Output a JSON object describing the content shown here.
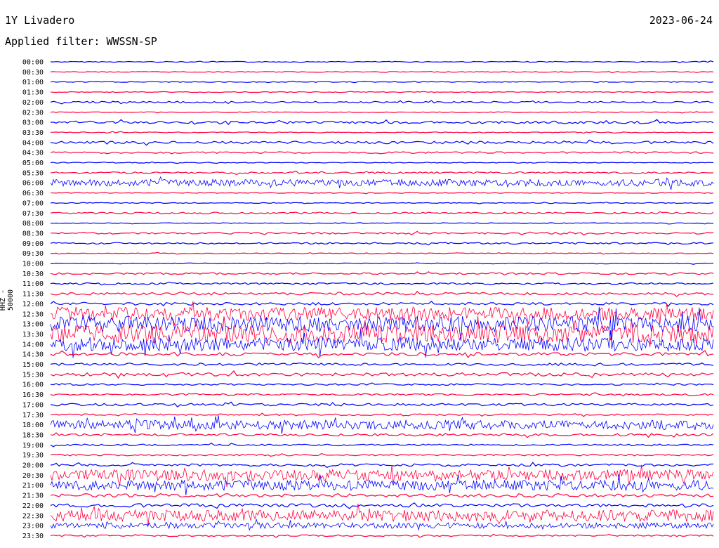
{
  "header": {
    "station": "1Y Livadero",
    "date": "2023-06-24",
    "filter": "Applied filter: WWSSN-SP"
  },
  "axis": {
    "ylabel": "HHZ - 50000"
  },
  "colors": {
    "line_a": "#0000ff",
    "line_b": "#ff0040",
    "text": "#000000"
  },
  "chart_data": {
    "type": "line",
    "title": "1Y Livadero",
    "ylabel": "HHZ - 50000",
    "grid": false,
    "alternating_colors": true,
    "rows": [
      {
        "time": "00:00",
        "amp": 1
      },
      {
        "time": "00:30",
        "amp": 1
      },
      {
        "time": "01:00",
        "amp": 1
      },
      {
        "time": "01:30",
        "amp": 1
      },
      {
        "time": "02:00",
        "amp": 2
      },
      {
        "time": "02:30",
        "amp": 1
      },
      {
        "time": "03:00",
        "amp": 3
      },
      {
        "time": "03:30",
        "amp": 1
      },
      {
        "time": "04:00",
        "amp": 3
      },
      {
        "time": "04:30",
        "amp": 2
      },
      {
        "time": "05:00",
        "amp": 1
      },
      {
        "time": "05:30",
        "amp": 2
      },
      {
        "time": "06:00",
        "amp": 6
      },
      {
        "time": "06:30",
        "amp": 1
      },
      {
        "time": "07:00",
        "amp": 1
      },
      {
        "time": "07:30",
        "amp": 2
      },
      {
        "time": "08:00",
        "amp": 1
      },
      {
        "time": "08:30",
        "amp": 2
      },
      {
        "time": "09:00",
        "amp": 2
      },
      {
        "time": "09:30",
        "amp": 1
      },
      {
        "time": "10:00",
        "amp": 1
      },
      {
        "time": "10:30",
        "amp": 2
      },
      {
        "time": "11:00",
        "amp": 2
      },
      {
        "time": "11:30",
        "amp": 3
      },
      {
        "time": "12:00",
        "amp": 3
      },
      {
        "time": "12:30",
        "amp": 12
      },
      {
        "time": "13:00",
        "amp": 14
      },
      {
        "time": "13:30",
        "amp": 16
      },
      {
        "time": "14:00",
        "amp": 12
      },
      {
        "time": "14:30",
        "amp": 4
      },
      {
        "time": "15:00",
        "amp": 3
      },
      {
        "time": "15:30",
        "amp": 4
      },
      {
        "time": "16:00",
        "amp": 2
      },
      {
        "time": "16:30",
        "amp": 2
      },
      {
        "time": "17:00",
        "amp": 3
      },
      {
        "time": "17:30",
        "amp": 2
      },
      {
        "time": "18:00",
        "amp": 8
      },
      {
        "time": "18:30",
        "amp": 3
      },
      {
        "time": "19:00",
        "amp": 2
      },
      {
        "time": "19:30",
        "amp": 2
      },
      {
        "time": "20:00",
        "amp": 3
      },
      {
        "time": "20:30",
        "amp": 10
      },
      {
        "time": "21:00",
        "amp": 9
      },
      {
        "time": "21:30",
        "amp": 4
      },
      {
        "time": "22:00",
        "amp": 4
      },
      {
        "time": "22:30",
        "amp": 10
      },
      {
        "time": "23:00",
        "amp": 5
      },
      {
        "time": "23:30",
        "amp": 2
      }
    ]
  }
}
